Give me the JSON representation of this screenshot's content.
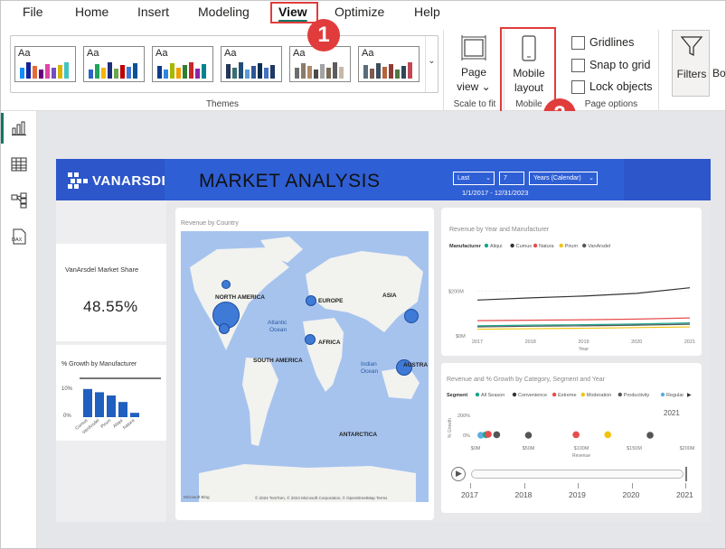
{
  "menu": {
    "items": [
      "File",
      "Home",
      "Insert",
      "Modeling",
      "View",
      "Optimize",
      "Help"
    ]
  },
  "ribbon": {
    "themes_label": "Themes",
    "theme_tile_text": "Aa",
    "scale": {
      "label_line1": "Page",
      "label_line2": "view",
      "group": "Scale to fit"
    },
    "mobile": {
      "label_line1": "Mobile",
      "label_line2": "layout",
      "group": "Mobile"
    },
    "page_options": {
      "gridlines": "Gridlines",
      "snap": "Snap to grid",
      "lock": "Lock objects",
      "group": "Page options"
    },
    "filters": "Filters",
    "cut_off": "Bo"
  },
  "callouts": {
    "one": "1",
    "two": "2"
  },
  "colors": {
    "highlight": "#e03c3c",
    "report_header": "#2c56c9",
    "map_water": "#a6c3ee",
    "bubble": "#3f7ad6"
  },
  "report": {
    "logo": "VANARSDEL",
    "title": "MARKET ANALYSIS",
    "filter_last": "Last",
    "filter_num": "7",
    "filter_period": "Years (Calendar)",
    "date_range": "1/1/2017 - 12/31/2023",
    "market_share_label": "VanArsdel Market Share",
    "market_share_value": "48.55%",
    "growth_title": "% Growth by Manufacturer",
    "growth_tick": "10%",
    "growth_zero": "0%",
    "growth_categories": [
      "Cumus",
      "VanArsdel",
      "Pirum",
      "Aliqui",
      "Natura"
    ],
    "map_title": "Revenue by Country",
    "map_labels": {
      "na": "NORTH AMERICA",
      "eu": "EUROPE",
      "asia": "ASIA",
      "africa": "AFRICA",
      "sa": "SOUTH AMERICA",
      "aus": "AUSTRA",
      "ant": "ANTARCTICA",
      "atl1": "Atlantic",
      "atl2": "Ocean",
      "ind1": "Indian",
      "ind2": "Ocean"
    },
    "map_footer": "© 2024 TomTom, © 2024 Microsoft Corporation, © OpenStreetMap Terms",
    "map_brand": "Microsoft Bing",
    "line_chart_title": "Revenue by Year and Manufacturer",
    "scatter_title": "Revenue and % Growth by Category, Segment and Year",
    "scatter_year": "2021",
    "timeline": [
      "2017",
      "2018",
      "2019",
      "2020",
      "2021"
    ]
  },
  "chart_data": [
    {
      "type": "bar",
      "title": "% Growth by Manufacturer",
      "categories": [
        "Cumus",
        "VanArsdel",
        "Pirum",
        "Aliqui",
        "Natura"
      ],
      "values": [
        13,
        11.5,
        10,
        7,
        2
      ],
      "ylim": [
        0,
        15
      ]
    },
    {
      "type": "line",
      "title": "Revenue by Year and Manufacturer",
      "legend_title": "Manufacturer",
      "x": [
        "2017",
        "2018",
        "2019",
        "2020",
        "2021"
      ],
      "ylabel_ticks": [
        "$200M",
        "$0M"
      ],
      "xlabel": "Year",
      "ylim": [
        0,
        250
      ],
      "series": [
        {
          "name": "Aliqui",
          "color": "#17a589",
          "values": [
            45,
            48,
            50,
            53,
            58
          ]
        },
        {
          "name": "Cumus",
          "color": "#333333",
          "values": [
            160,
            170,
            178,
            190,
            215
          ]
        },
        {
          "name": "Natura",
          "color": "#e74c4c",
          "values": [
            68,
            70,
            72,
            75,
            80
          ]
        },
        {
          "name": "Pirum",
          "color": "#f1c40f",
          "values": [
            30,
            32,
            34,
            37,
            40
          ]
        },
        {
          "name": "VanArsdel",
          "color": "#555555",
          "values": [
            40,
            43,
            45,
            48,
            52
          ]
        }
      ]
    },
    {
      "type": "scatter",
      "title": "Revenue and % Growth by Category, Segment and Year",
      "legend_title": "Segment",
      "legend": [
        "All Season",
        "Convenience",
        "Extreme",
        "Moderation",
        "Productivity",
        "Regular"
      ],
      "legend_colors": [
        "#17a589",
        "#333333",
        "#e74c4c",
        "#f1c40f",
        "#555555",
        "#5dade2"
      ],
      "xlabel": "Revenue",
      "ylabel": "% Growth",
      "x_ticks": [
        "$0M",
        "$50M",
        "$100M",
        "$150M",
        "$200M"
      ],
      "y_ticks": [
        "200%",
        "0%"
      ],
      "points": [
        {
          "x": 5,
          "y": 0,
          "c": "#5dade2"
        },
        {
          "x": 10,
          "y": 5,
          "c": "#17a589"
        },
        {
          "x": 12,
          "y": 10,
          "c": "#e74c4c"
        },
        {
          "x": 20,
          "y": 5,
          "c": "#555555"
        },
        {
          "x": 50,
          "y": 0,
          "c": "#555555"
        },
        {
          "x": 95,
          "y": 5,
          "c": "#e74c4c"
        },
        {
          "x": 125,
          "y": 5,
          "c": "#f1c40f"
        },
        {
          "x": 165,
          "y": 0,
          "c": "#555555"
        }
      ]
    }
  ]
}
